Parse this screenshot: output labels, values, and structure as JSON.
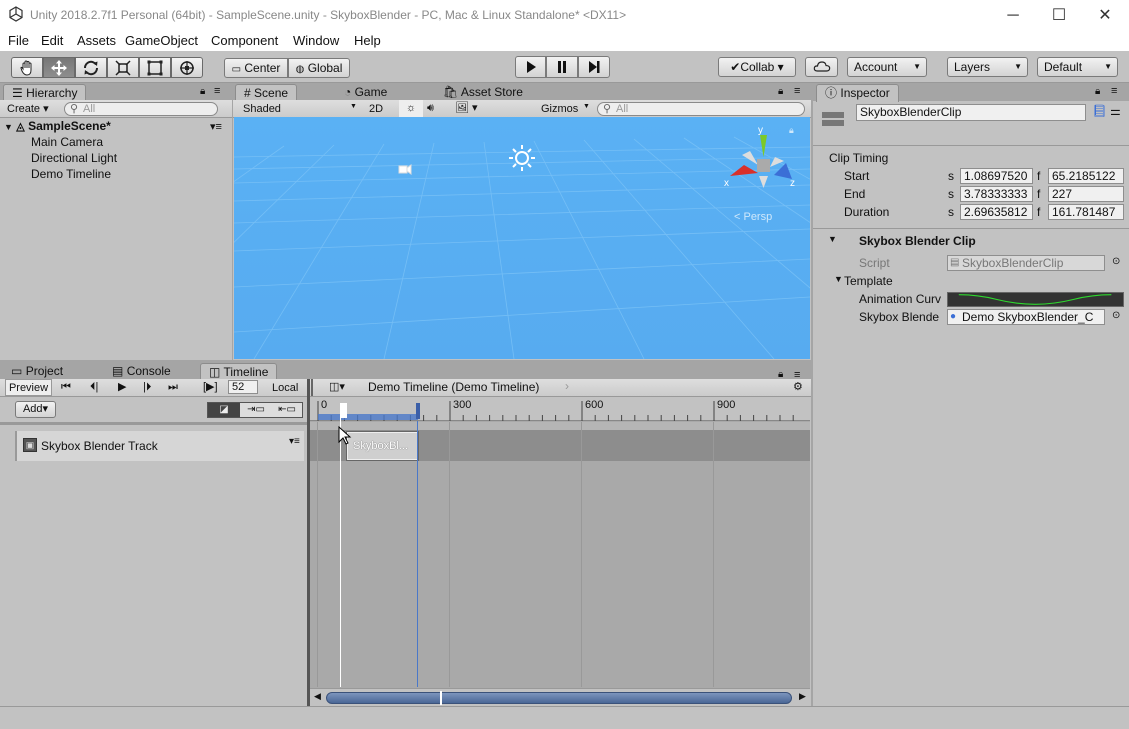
{
  "window": {
    "title": "Unity 2018.2.7f1 Personal (64bit) - SampleScene.unity - SkyboxBlender - PC, Mac & Linux Standalone* <DX11>",
    "minimize": "─",
    "maximize": "☐",
    "close": "✕"
  },
  "menu": [
    "File",
    "Edit",
    "Assets",
    "GameObject",
    "Component",
    "Window",
    "Help"
  ],
  "toolbar": {
    "pivot": "Center",
    "space": "Global",
    "collab": "Collab ▾",
    "account": "Account",
    "layers": "Layers",
    "layout": "Default"
  },
  "hierarchy": {
    "tab": "Hierarchy",
    "create": "Create ▾",
    "search_placeholder": "All",
    "scene": "SampleScene*",
    "items": [
      "Main Camera",
      "Directional Light",
      "Demo Timeline"
    ]
  },
  "scene": {
    "tabs": [
      "Scene",
      "Game",
      "Asset Store"
    ],
    "shading": "Shaded",
    "mode2d": "2D",
    "gizmos": "Gizmos",
    "search_placeholder": "All",
    "persp": "< Persp",
    "axis_x": "x",
    "axis_y": "y",
    "axis_z": "z"
  },
  "bottom_tabs": [
    "Project",
    "Console",
    "Timeline"
  ],
  "timeline": {
    "preview": "Preview",
    "frame": "52",
    "local": "Local",
    "play_range": "[▶]",
    "add": "Add▾",
    "breadcrumb": "Demo Timeline (Demo Timeline)",
    "track_name": "Skybox Blender Track",
    "clip_name": "SkyboxBl...",
    "ruler_labels": [
      "0",
      "300",
      "600",
      "900"
    ],
    "playhead_frame": 52,
    "clip_start_frame": 65.2,
    "clip_end_frame": 227
  },
  "inspector": {
    "tab": "Inspector",
    "object_name": "SkyboxBlenderClip",
    "clip_timing_header": "Clip Timing",
    "rows": [
      {
        "label": "Start",
        "s_unit": "s",
        "s_value": "1.08697520",
        "f_unit": "f",
        "f_value": "65.2185122"
      },
      {
        "label": "End",
        "s_unit": "s",
        "s_value": "3.78333333",
        "f_unit": "f",
        "f_value": "227"
      },
      {
        "label": "Duration",
        "s_unit": "s",
        "s_value": "2.69635812",
        "f_unit": "f",
        "f_value": "161.781487"
      }
    ],
    "component_title": "Skybox Blender Clip",
    "script_label": "Script",
    "script_value": "SkyboxBlenderClip",
    "template_label": "Template",
    "anim_curve_label": "Animation Curv",
    "skybox_label": "Skybox Blende",
    "skybox_value": "Demo SkyboxBlender_C"
  },
  "colors": {
    "scene_sky": "#5ab1f4",
    "curve_green": "#2fd92f",
    "axis_x_red": "#d9302b",
    "axis_y_green": "#7cc929",
    "axis_z_blue": "#3b6fd6",
    "timeline_blue": "#4a78c9"
  }
}
